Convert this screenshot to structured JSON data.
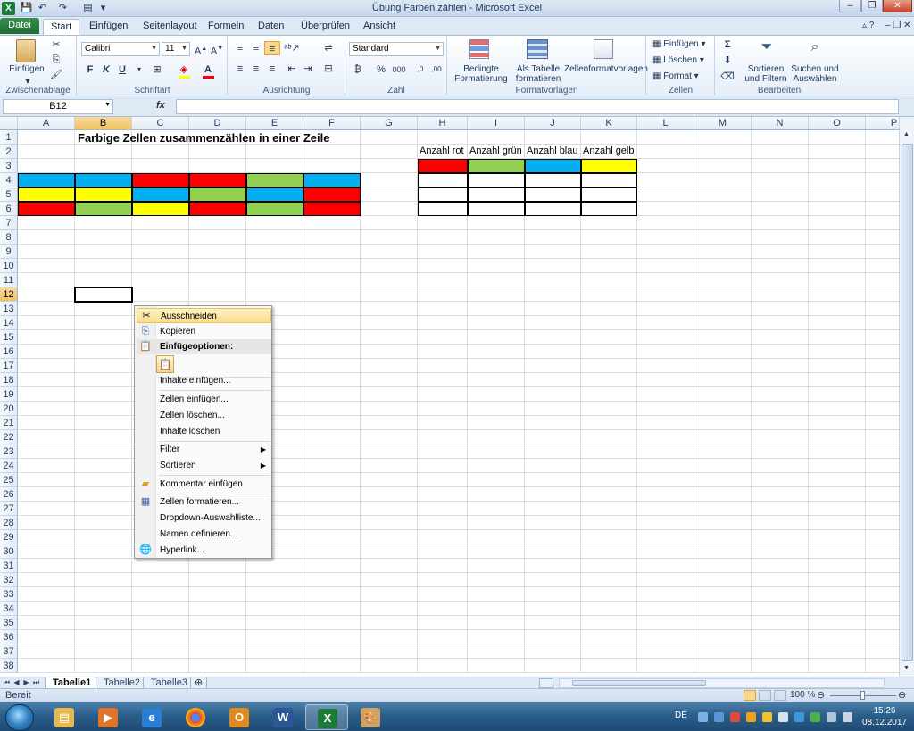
{
  "window": {
    "title": "Übung Farben zählen  -  Microsoft Excel",
    "minimize": "‒",
    "restore": "❐",
    "close": "✕"
  },
  "ribbon_tabs": {
    "file": "Datei",
    "items": [
      "Start",
      "Einfügen",
      "Seitenlayout",
      "Formeln",
      "Daten",
      "Überprüfen",
      "Ansicht"
    ]
  },
  "ribbon": {
    "clipboard": {
      "paste": "Einfügen",
      "group": "Zwischenablage"
    },
    "font": {
      "name": "Calibri",
      "size": "11",
      "bold": "F",
      "italic": "K",
      "underline": "U",
      "group": "Schriftart"
    },
    "alignment": {
      "group": "Ausrichtung"
    },
    "number": {
      "format": "Standard",
      "percent": "%",
      "thousands": "000",
      "group": "Zahl"
    },
    "styles": {
      "conditional": "Bedingte\nFormatierung",
      "conditional_1": "Bedingte",
      "conditional_2": "Formatierung",
      "table_1": "Als Tabelle",
      "table_2": "formatieren",
      "cellstyles": "Zellenformatvorlagen",
      "group": "Formatvorlagen"
    },
    "cells": {
      "insert": "Einfügen",
      "delete": "Löschen",
      "format": "Format",
      "group": "Zellen"
    },
    "editing": {
      "sum": "Σ",
      "sort_1": "Sortieren",
      "sort_2": "und Filtern",
      "find_1": "Suchen und",
      "find_2": "Auswählen",
      "group": "Bearbeiten"
    }
  },
  "formula_bar": {
    "name_box": "B12",
    "fx": "fx",
    "formula": ""
  },
  "columns": [
    "A",
    "B",
    "C",
    "D",
    "E",
    "F",
    "G",
    "H",
    "I",
    "J",
    "K",
    "L",
    "M",
    "N",
    "O",
    "P"
  ],
  "rows": [
    "1",
    "2",
    "3",
    "4",
    "5",
    "6",
    "7",
    "8",
    "9",
    "10",
    "11",
    "12",
    "13",
    "14",
    "15",
    "16",
    "17",
    "18",
    "19",
    "20",
    "21",
    "22",
    "23",
    "24",
    "25",
    "26",
    "27",
    "28",
    "29",
    "30",
    "31",
    "32",
    "33",
    "34",
    "35",
    "36",
    "37",
    "38"
  ],
  "sheet": {
    "title": "Farbige Zellen zusammenzählen in einer Zeile",
    "count_headers": [
      "Anzahl rot",
      "Anzahl grün",
      "Anzahl blau",
      "Anzahl gelb"
    ],
    "count_header_colors": [
      "#ff0000",
      "#92d050",
      "#00b0f0",
      "#ffff00"
    ],
    "colored_rows": [
      [
        "#00b0f0",
        "#00b0f0",
        "#ff0000",
        "#ff0000",
        "#92d050",
        "#00b0f0"
      ],
      [
        "#ffff00",
        "#ffff00",
        "#00b0f0",
        "#92d050",
        "#00b0f0",
        "#ff0000"
      ],
      [
        "#ff0000",
        "#92d050",
        "#ffff00",
        "#ff0000",
        "#92d050",
        "#ff0000"
      ]
    ],
    "selected_cell": "B12"
  },
  "context_menu": {
    "cut": "Ausschneiden",
    "copy": "Kopieren",
    "paste_options": "Einfügeoptionen:",
    "paste_special": "Inhalte einfügen...",
    "insert_cells": "Zellen einfügen...",
    "delete_cells": "Zellen löschen...",
    "clear": "Inhalte löschen",
    "filter": "Filter",
    "sort": "Sortieren",
    "comment": "Kommentar einfügen",
    "format_cells": "Zellen formatieren...",
    "dropdown": "Dropdown-Auswahlliste...",
    "name": "Namen definieren...",
    "hyperlink": "Hyperlink..."
  },
  "sheet_tabs": [
    "Tabelle1",
    "Tabelle2",
    "Tabelle3"
  ],
  "status": {
    "ready": "Bereit",
    "zoom": "100 %"
  },
  "taskbar": {
    "lang": "DE",
    "time": "15:26",
    "date": "08.12.2017"
  }
}
